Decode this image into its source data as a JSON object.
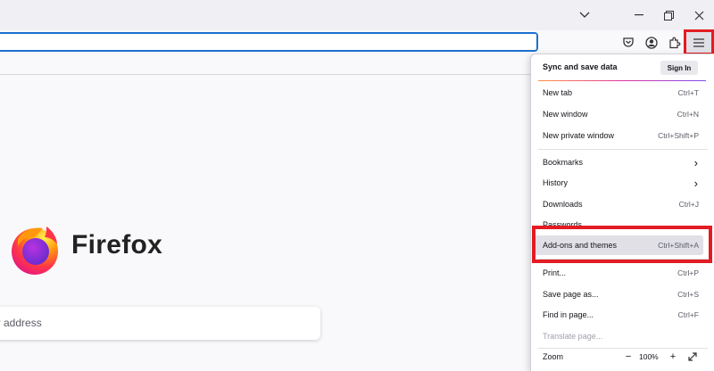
{
  "titlebar": {
    "tab_list_icon": "chevron-down-icon",
    "minimize_icon": "minimize-icon",
    "restore_icon": "restore-icon",
    "close_icon": "close-icon"
  },
  "navbar": {
    "url_value": "",
    "icons": [
      "pocket-icon",
      "account-icon",
      "extensions-icon",
      "hamburger-menu-icon"
    ]
  },
  "newtab": {
    "brand": "Firefox",
    "search_placeholder": "er address"
  },
  "menu": {
    "sync_label": "Sync and save data",
    "sign_in": "Sign In",
    "items": [
      {
        "label": "New tab",
        "shortcut": "Ctrl+T"
      },
      {
        "label": "New window",
        "shortcut": "Ctrl+N"
      },
      {
        "label": "New private window",
        "shortcut": "Ctrl+Shift+P"
      },
      {
        "label": "Bookmarks",
        "shortcut": ""
      },
      {
        "label": "History",
        "shortcut": ""
      },
      {
        "label": "Downloads",
        "shortcut": "Ctrl+J"
      },
      {
        "label": "Passwords",
        "shortcut": ""
      },
      {
        "label": "Add-ons and themes",
        "shortcut": "Ctrl+Shift+A"
      },
      {
        "label": "Print...",
        "shortcut": "Ctrl+P"
      },
      {
        "label": "Save page as...",
        "shortcut": "Ctrl+S"
      },
      {
        "label": "Find in page...",
        "shortcut": "Ctrl+F"
      },
      {
        "label": "Translate page...",
        "shortcut": ""
      }
    ],
    "zoom": {
      "label": "Zoom",
      "value": "100%",
      "minus": "−",
      "plus": "+"
    }
  },
  "colors": {
    "accent": "#1c6fd0",
    "highlight_red": "#e31c23"
  }
}
